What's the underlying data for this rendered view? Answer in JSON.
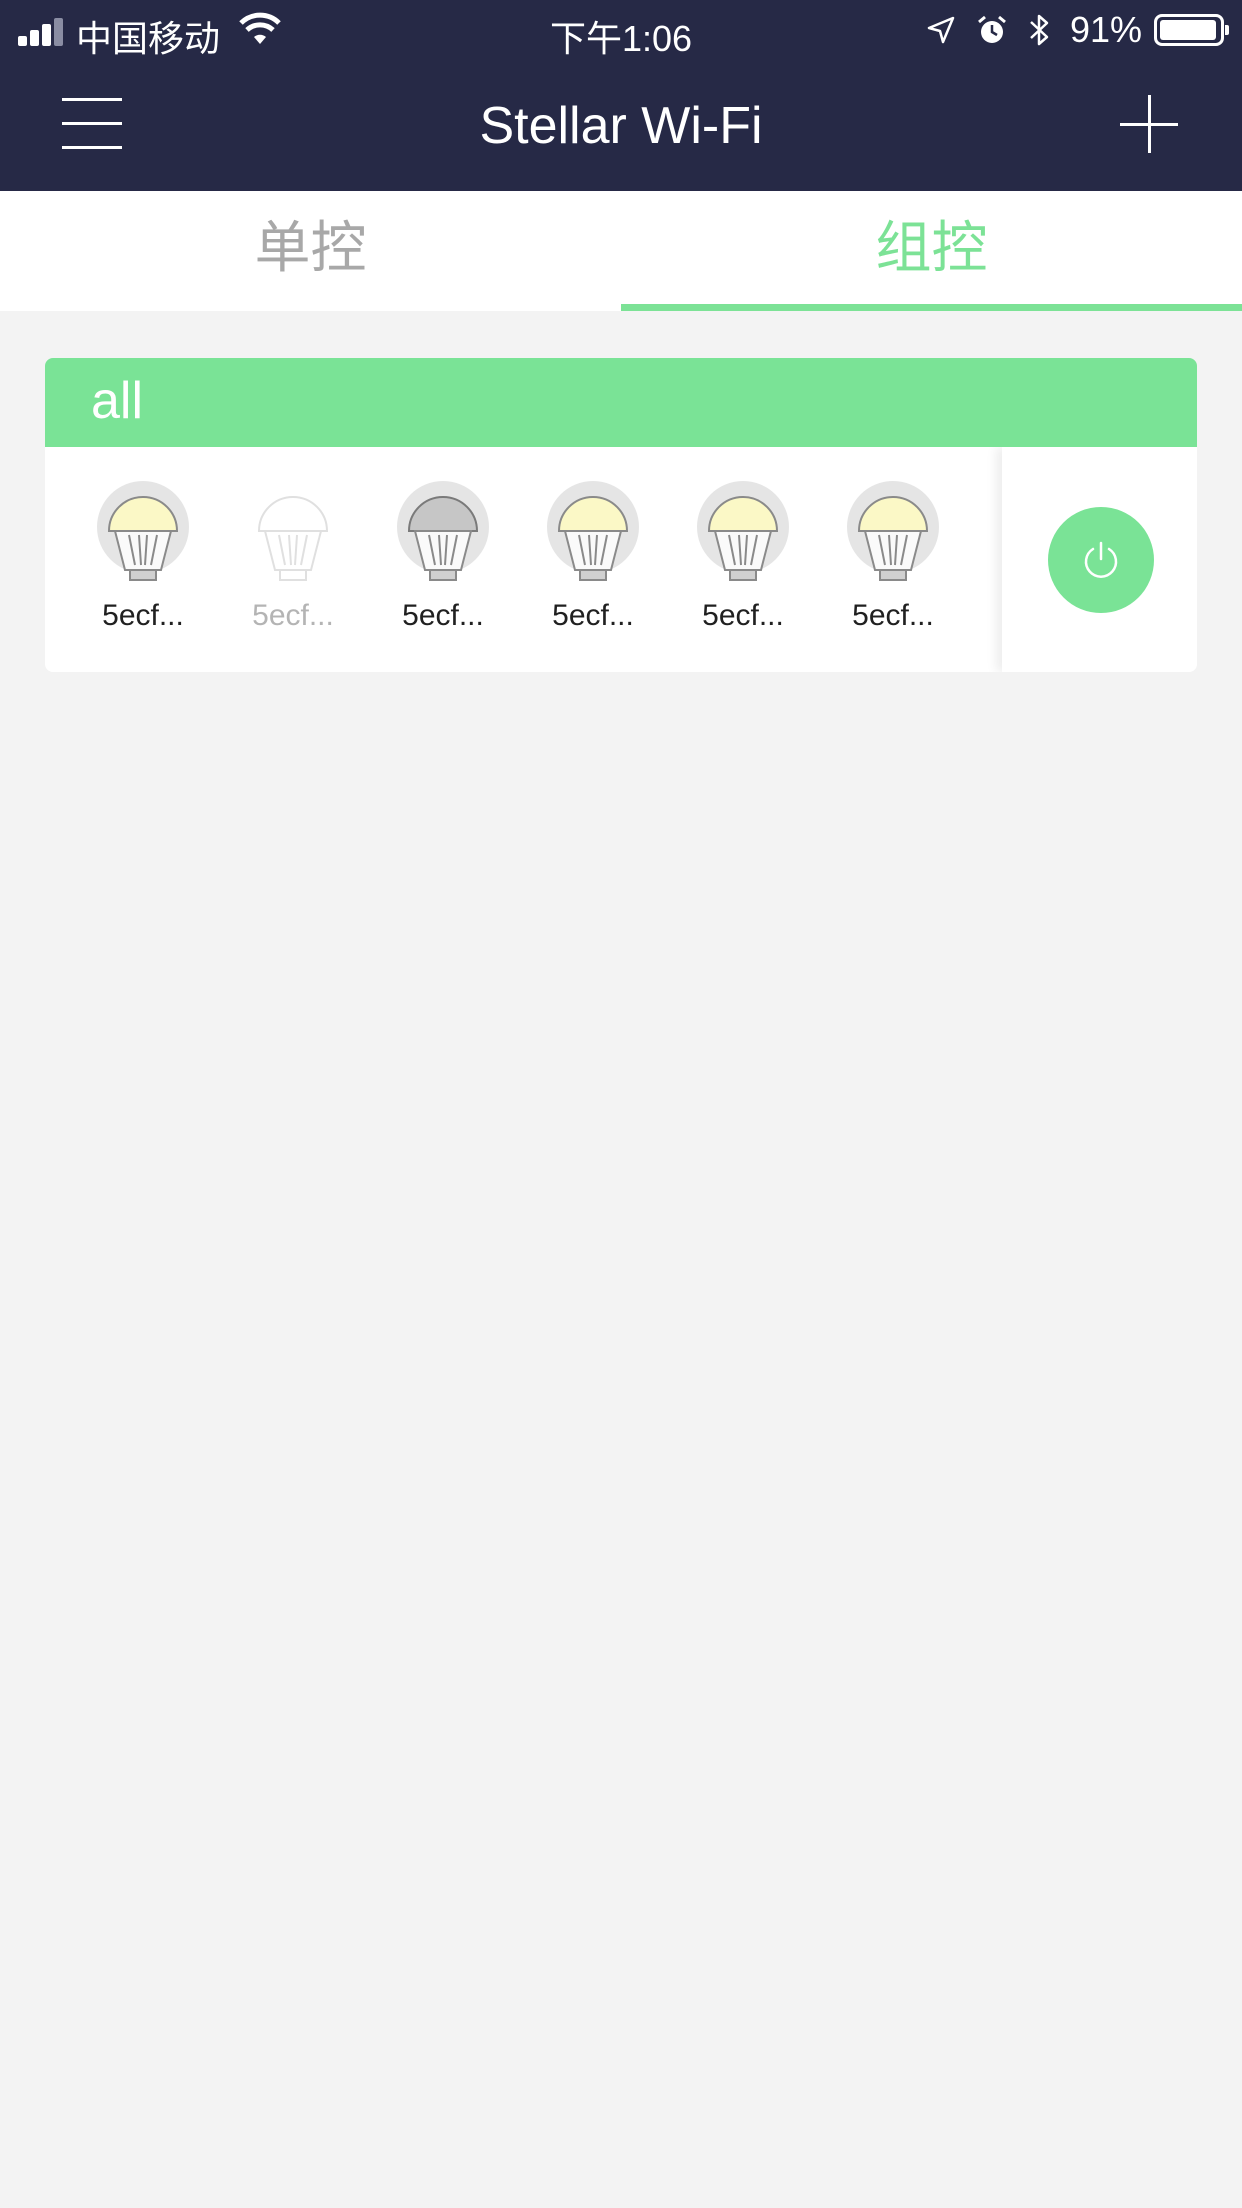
{
  "status_bar": {
    "carrier": "中国移动",
    "time": "下午1:06",
    "battery_percent": "91%",
    "icons": [
      "signal-icon",
      "wifi-icon",
      "location-icon",
      "alarm-icon",
      "bluetooth-icon",
      "battery-icon"
    ]
  },
  "nav": {
    "title": "Stellar Wi-Fi",
    "menu_icon": "menu-icon",
    "add_icon": "add-icon"
  },
  "tabs": [
    {
      "label": "单控",
      "active": false
    },
    {
      "label": "组控",
      "active": true
    }
  ],
  "group": {
    "name": "all",
    "devices": [
      {
        "name": "5ecf...",
        "state": "on"
      },
      {
        "name": "5ecf...",
        "state": "offline"
      },
      {
        "name": "5ecf...",
        "state": "off"
      },
      {
        "name": "5ecf...",
        "state": "on"
      },
      {
        "name": "5ecf...",
        "state": "on"
      },
      {
        "name": "5ecf...",
        "state": "on"
      }
    ],
    "power_icon": "power-icon"
  },
  "colors": {
    "header_bg": "#262946",
    "accent": "#7ae396",
    "page_bg": "#f3f3f3"
  }
}
